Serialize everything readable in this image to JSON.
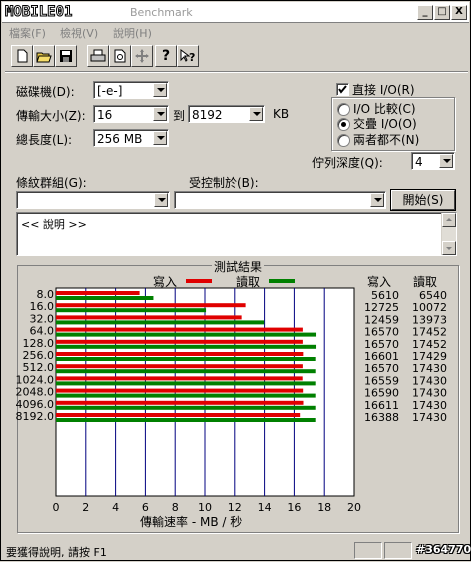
{
  "title": {
    "logo_text": "MOBILE01",
    "app_title": "Benchmark"
  },
  "window_buttons": {
    "minimize": "_",
    "maximize": "□",
    "close": "X"
  },
  "menu": {
    "file": "檔案(F)",
    "view": "檢視(V)",
    "help": "說明(H)"
  },
  "toolbar": {
    "icons": [
      "new-icon",
      "open-icon",
      "save-icon",
      "print-icon",
      "print-preview-icon",
      "move-icon",
      "help-icon",
      "context-help-icon"
    ]
  },
  "form": {
    "drive_label": "磁碟機(D):",
    "drive_value": "[-e-]",
    "transfer_label": "傳輸大小(Z):",
    "transfer_from": "16",
    "to_label": "到",
    "transfer_to": "8192",
    "kb_label": "KB",
    "length_label": "總長度(L):",
    "length_value": "256 MB",
    "direct_io_label": "直接 I/O(R)",
    "direct_io_checked": true,
    "io_compare_label": "I/O 比較(C)",
    "overlap_io_label": "交疊 I/O(O)",
    "neither_label": "兩者都不(N)",
    "queue_depth_label": "佇列深度(Q):",
    "queue_depth_value": "4",
    "test_group_label": "條紋群組(G):",
    "controlled_by_label": "受控制於(B):",
    "start_button": "開始(S)",
    "description_text": "<< 說明 >>"
  },
  "results": {
    "group_title": "測試結果",
    "write_header": "寫入",
    "read_header": "讀取",
    "col_write": "寫入",
    "col_read": "讀取",
    "xlabel": "傳輸速率 - MB / 秒"
  },
  "chart_data": {
    "type": "bar",
    "orientation": "horizontal",
    "categories": [
      "8.0",
      "16.0",
      "32.0",
      "64.0",
      "128.0",
      "256.0",
      "512.0",
      "1024.0",
      "2048.0",
      "4096.0",
      "8192.0"
    ],
    "series": [
      {
        "name": "寫入",
        "color": "#e00000",
        "values": [
          5610,
          12725,
          12459,
          16570,
          16570,
          16601,
          16570,
          16559,
          16590,
          16611,
          16388
        ]
      },
      {
        "name": "讀取",
        "color": "#008000",
        "values": [
          6540,
          10072,
          13973,
          17452,
          17452,
          17429,
          17430,
          17430,
          17430,
          17430,
          17430
        ]
      }
    ],
    "xlim": [
      0,
      20
    ],
    "xticks": [
      "0",
      "2",
      "4",
      "6",
      "8",
      "10",
      "12",
      "14",
      "16",
      "18",
      "20"
    ],
    "xlabel": "傳輸速率 - MB / 秒",
    "grid": true,
    "legend": "top"
  },
  "status": {
    "help_text": "要獲得說明, 請按 F1",
    "watermark": "#364770"
  }
}
